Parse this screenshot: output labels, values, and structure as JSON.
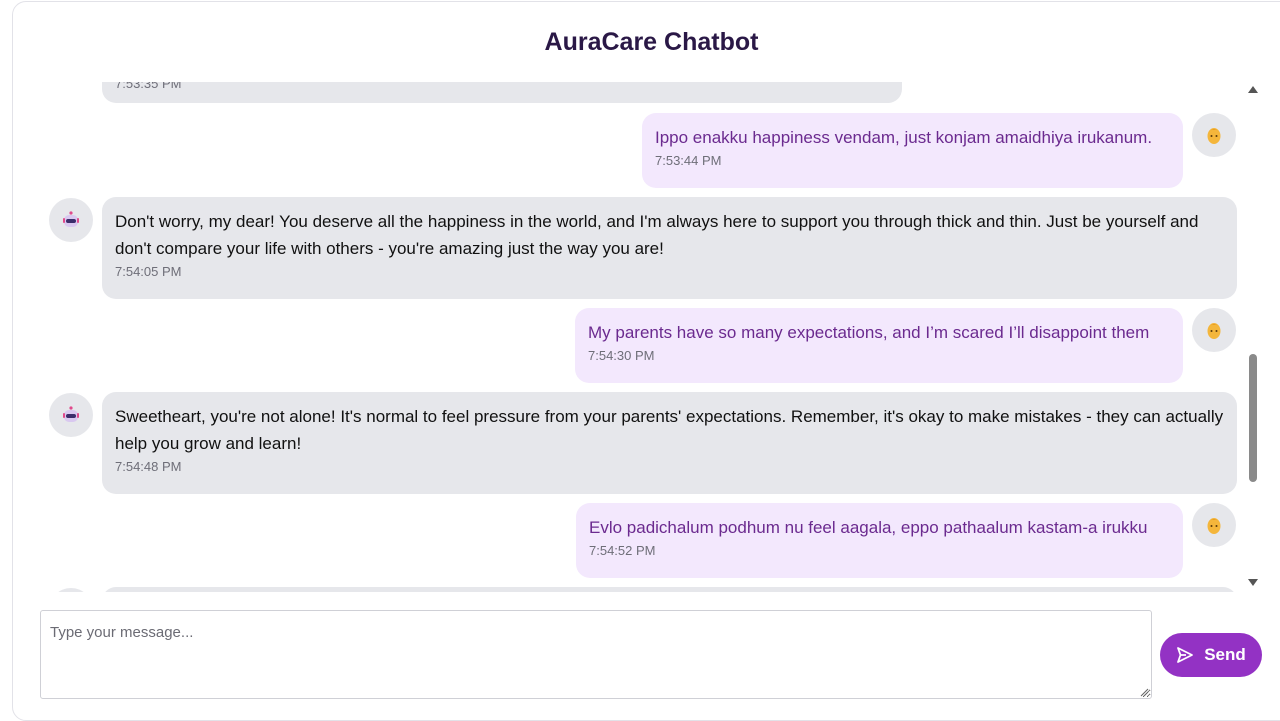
{
  "header": {
    "title": "AuraCare Chatbot"
  },
  "messages": [
    {
      "role": "bot",
      "text": "",
      "time": "7:53:35 PM"
    },
    {
      "role": "user",
      "text": "Ippo enakku happiness vendam, just konjam amaidhiya irukanum.",
      "time": "7:53:44 PM"
    },
    {
      "role": "bot",
      "text": "Don't worry, my dear! You deserve all the happiness in the world, and I'm always here to support you through thick and thin. Just be yourself and don't compare your life with others - you're amazing just the way you are!",
      "time": "7:54:05 PM"
    },
    {
      "role": "user",
      "text": "My parents have so many expectations, and I’m scared I’ll disappoint them",
      "time": "7:54:30 PM"
    },
    {
      "role": "bot",
      "text": "Sweetheart, you're not alone! It's normal to feel pressure from your parents' expectations. Remember, it's okay to make mistakes - they can actually help you grow and learn!",
      "time": "7:54:48 PM"
    },
    {
      "role": "user",
      "text": "Evlo padichalum podhum nu feel aagala, eppo pathaalum kastam-a irukku",
      "time": "7:54:52 PM"
    }
  ],
  "composer": {
    "placeholder": "Type your message...",
    "send_label": "Send"
  },
  "icons": {
    "bot_avatar": "robot-icon",
    "user_avatar": "person-icon",
    "send": "send-icon"
  },
  "colors": {
    "accent": "#9332c4",
    "user_bubble": "#f3e8fd",
    "bot_bubble": "#e6e7eb",
    "title": "#2a1846"
  }
}
